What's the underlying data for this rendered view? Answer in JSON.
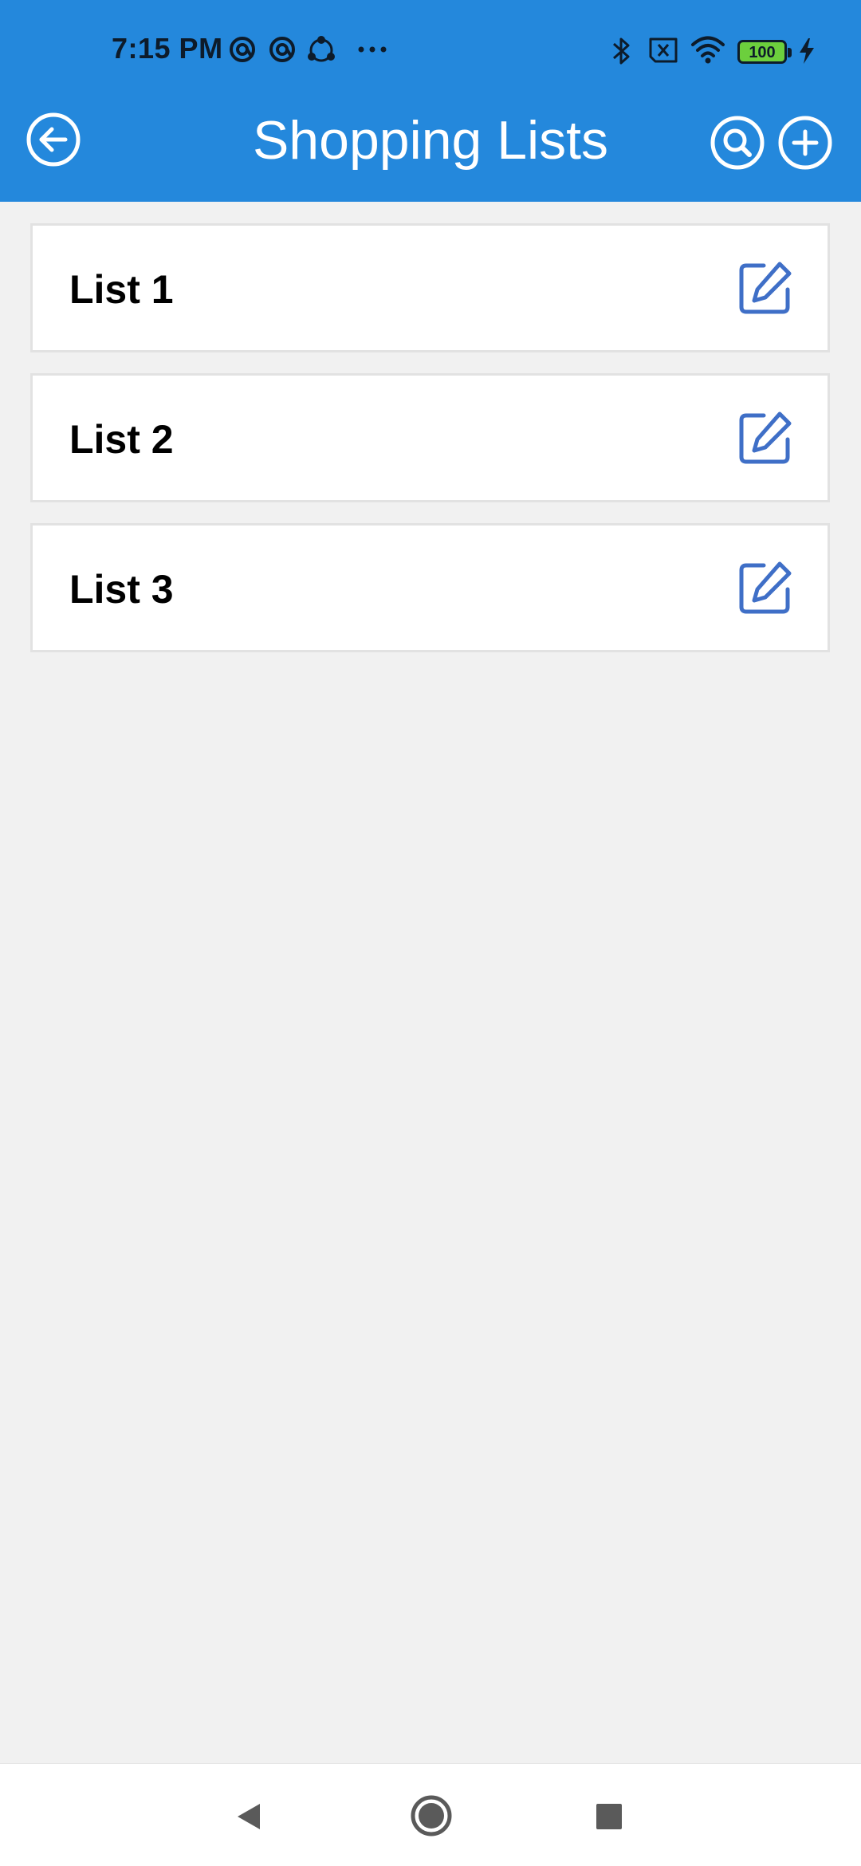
{
  "status_bar": {
    "time": "7:15 PM",
    "battery_level": "100",
    "notification_icons": [
      "at-sign-icon",
      "at-sign-icon",
      "share-nodes-icon",
      "more-dots-icon"
    ],
    "system_icons": [
      "bluetooth-icon",
      "no-sim-icon",
      "wifi-icon",
      "battery-icon",
      "charging-bolt-icon"
    ]
  },
  "toolbar": {
    "title": "Shopping Lists",
    "back_icon": "arrow-left-circle-icon",
    "search_icon": "search-circle-icon",
    "add_icon": "plus-circle-icon"
  },
  "lists": {
    "items": [
      {
        "label": "List 1",
        "icon": "edit-icon"
      },
      {
        "label": "List 2",
        "icon": "edit-icon"
      },
      {
        "label": "List 3",
        "icon": "edit-icon"
      }
    ]
  },
  "nav_bar": {
    "back_icon": "nav-back-icon",
    "home_icon": "nav-home-icon",
    "recents_icon": "nav-recents-icon"
  },
  "colors": {
    "app_bar": "#2488dc",
    "background": "#f1f1f1",
    "edit_icon": "#3f6fc7",
    "title_text": "#ffffff"
  }
}
